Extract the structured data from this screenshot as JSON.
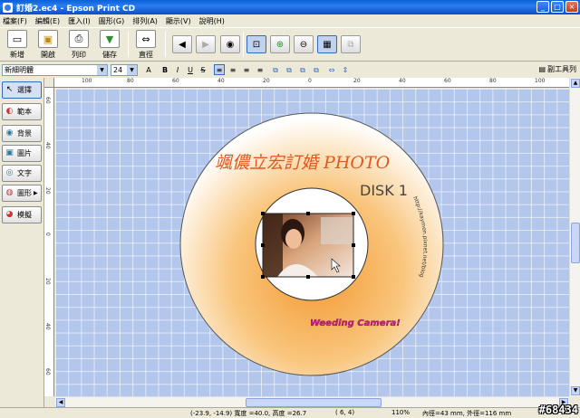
{
  "window": {
    "title": "訂婚2.ec4 - Epson Print CD"
  },
  "menu": [
    "檔案(F)",
    "編輯(E)",
    "匯入(I)",
    "圖形(G)",
    "排列(A)",
    "顯示(V)",
    "說明(H)"
  ],
  "toolbar": {
    "new_label": "新增",
    "open_label": "開啟",
    "print_label": "列印",
    "save_label": "儲存",
    "layout_label": "直徑"
  },
  "format": {
    "font": "新細明體",
    "size": "24",
    "bold": "B",
    "italic": "I",
    "underline": "U",
    "strike": "S",
    "sub_toolbar_label": "副工具列"
  },
  "left_panel": {
    "select": "選擇",
    "template": "範本",
    "background": "背景",
    "image": "圖片",
    "text": "文字",
    "shape": "圖形",
    "fit": "模擬"
  },
  "ruler": {
    "top": [
      "100",
      "80",
      "60",
      "40",
      "20",
      "0",
      "20",
      "40",
      "60",
      "80",
      "100"
    ],
    "left": [
      "60",
      "40",
      "20",
      "0",
      "20",
      "40",
      "60"
    ]
  },
  "disc": {
    "title": "颯儂立宏訂婚 PHOTO",
    "disk_label": "DISK 1",
    "url": "http://kaymen.pixnet.net/blog",
    "caption": "Weeding Camera!",
    "title_color": "#e0581f",
    "caption_color": "#d21a8c"
  },
  "status": {
    "coords": "(-23.9, -14.9) 寬度 =40.0, 高度 =26.7",
    "page": "( 6,  4)",
    "zoom": "110%",
    "diam": "內徑=43 mm, 外徑=116 mm"
  },
  "watermark": "#68434",
  "colors": {
    "canvas": "#b3c6ec",
    "titlebar": "#0a5fd8",
    "disc_orange": "#f6a94b"
  }
}
